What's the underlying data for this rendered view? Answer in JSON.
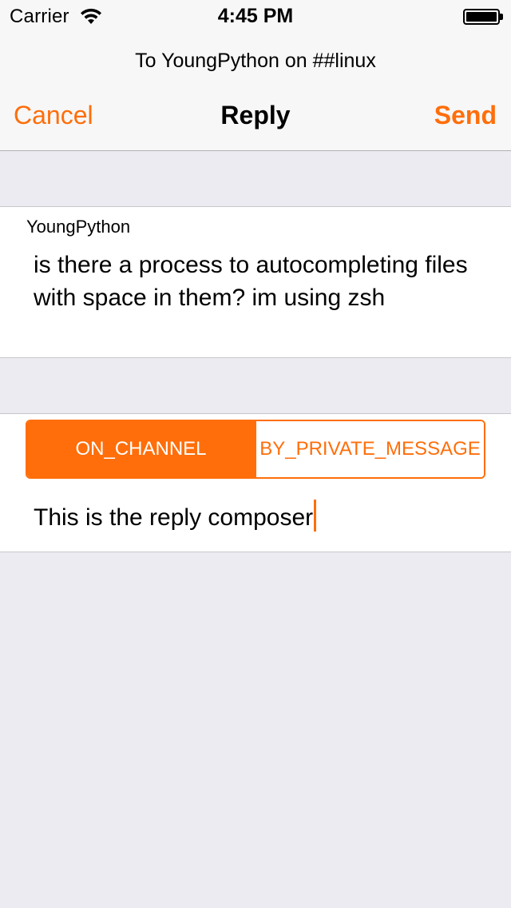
{
  "status_bar": {
    "carrier": "Carrier",
    "time": "4:45 PM",
    "wifi_icon": "wifi-icon",
    "battery_icon": "battery-icon"
  },
  "header": {
    "subtitle": "To YoungPython on ##linux",
    "cancel_label": "Cancel",
    "title": "Reply",
    "send_label": "Send"
  },
  "original_message": {
    "nick": "YoungPython",
    "text": "is there a process to autocompleting files with space in them? im using zsh"
  },
  "reply": {
    "modes": [
      "ON_CHANNEL",
      "BY_PRIVATE_MESSAGE"
    ],
    "selected_mode": "ON_CHANNEL",
    "composer_text": "This is the reply composer"
  },
  "colors": {
    "accent": "#ff6e0a",
    "background": "#ebebf1",
    "bar": "#f7f7f7"
  }
}
